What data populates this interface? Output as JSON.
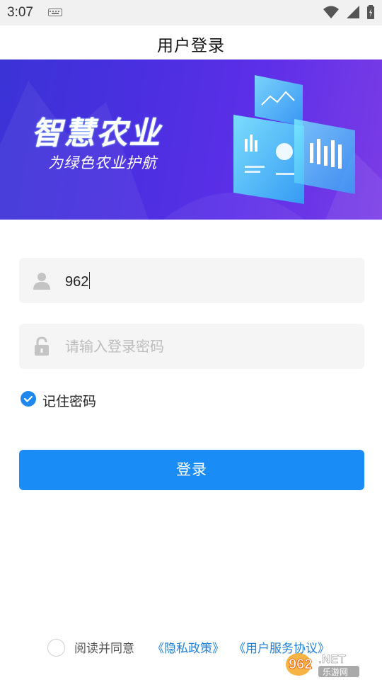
{
  "status_bar": {
    "time": "3:07",
    "icons": [
      "keyboard-icon",
      "wifi-icon",
      "signal-icon",
      "battery-icon"
    ]
  },
  "header": {
    "title": "用户登录"
  },
  "banner": {
    "title": "智慧农业",
    "subtitle": "为绿色农业护航"
  },
  "login_form": {
    "username_value": "962",
    "password_placeholder": "请输入登录密码",
    "remember_label": "记住密码",
    "remember_checked": true,
    "login_button": "登录"
  },
  "agreement": {
    "text": "阅读并同意",
    "privacy_link": "《隐私政策》",
    "service_link": "《用户服务协议》",
    "agreed": false
  },
  "watermark": {
    "brand": "962.NET",
    "caption": "乐游网"
  },
  "colors": {
    "accent": "#1a8cf5",
    "link": "#1e7fd8",
    "banner_start": "#3b33d6",
    "banner_end": "#7a3ce6"
  }
}
